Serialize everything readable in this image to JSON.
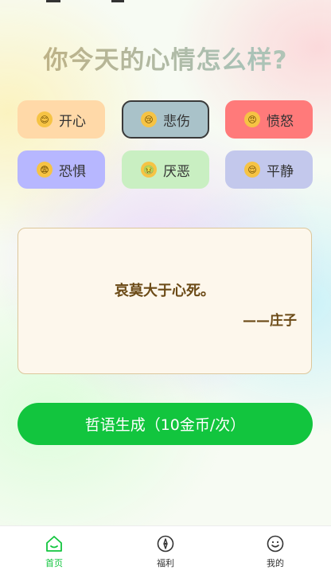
{
  "page_title": "你今天的心情怎么样?",
  "moods": [
    {
      "emoji_text": "😊",
      "label": "开心",
      "bg": "#ffd9a8",
      "emoji_icon": "smiling-face-icon",
      "selected": false
    },
    {
      "emoji_text": "😢",
      "label": "悲伤",
      "bg": "#a9c2c9",
      "emoji_icon": "crying-face-icon",
      "selected": true
    },
    {
      "emoji_text": "😠",
      "label": "愤怒",
      "bg": "#ff7a7a",
      "emoji_icon": "angry-face-icon",
      "selected": false
    },
    {
      "emoji_text": "😨",
      "label": "恐惧",
      "bg": "#b7b7ff",
      "emoji_icon": "fearful-face-icon",
      "selected": false
    },
    {
      "emoji_text": "🤢",
      "label": "厌恶",
      "bg": "#c9efc2",
      "emoji_icon": "nauseated-face-icon",
      "selected": false
    },
    {
      "emoji_text": "😌",
      "label": "平静",
      "bg": "#c3c8ec",
      "emoji_icon": "relieved-face-icon",
      "selected": false
    }
  ],
  "quote": {
    "text": "哀莫大于心死。",
    "author": "——庄子"
  },
  "generate_button": "哲语生成（10金币/次）",
  "tabs": [
    {
      "label": "首页",
      "icon": "home-icon",
      "active": true
    },
    {
      "label": "福利",
      "icon": "compass-icon",
      "active": false
    },
    {
      "label": "我的",
      "icon": "smiley-icon",
      "active": false
    }
  ],
  "colors": {
    "accent": "#12c53e",
    "quote_text": "#6b4a16",
    "quote_bg": "#fdf7ec",
    "quote_border": "#dcc79b"
  }
}
